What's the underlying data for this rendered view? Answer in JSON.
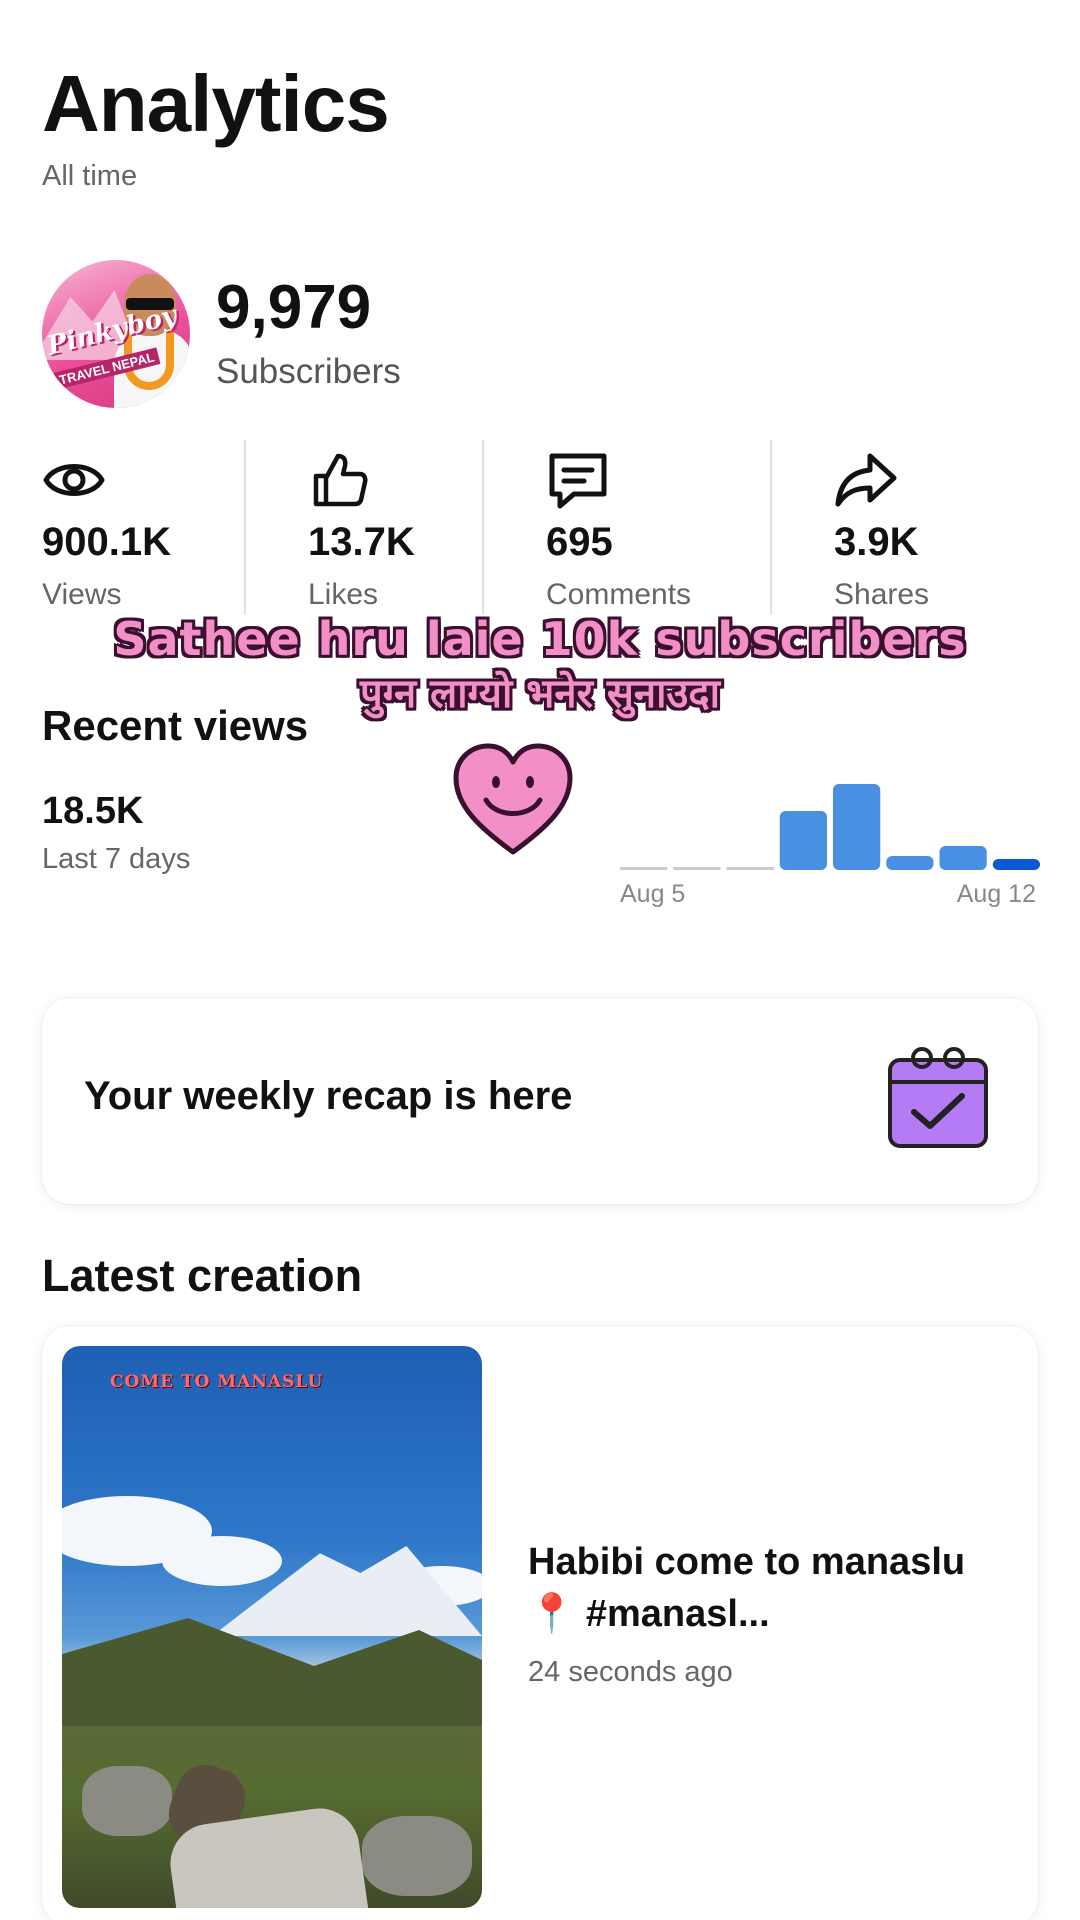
{
  "header": {
    "title": "Analytics",
    "subtitle": "All time"
  },
  "profile": {
    "avatar_brand": "Pinkyboy",
    "avatar_brand_sub": "TRAVEL NEPAL",
    "subscribers": "9,979",
    "subscribers_label": "Subscribers"
  },
  "stats": [
    {
      "icon": "eye-icon",
      "value": "900.1K",
      "label": "Views"
    },
    {
      "icon": "thumbs-up-icon",
      "value": "13.7K",
      "label": "Likes"
    },
    {
      "icon": "comment-icon",
      "value": "695",
      "label": "Comments"
    },
    {
      "icon": "share-icon",
      "value": "3.9K",
      "label": "Shares"
    }
  ],
  "overlay": {
    "line1": "Sathee hru laie 10k subscribers",
    "line2": "पुग्न लाग्यो भनेर सुनाउदा"
  },
  "recent_views": {
    "title": "Recent views",
    "count": "18.5K",
    "period": "Last 7 days",
    "x_start": "Aug 5",
    "x_end": "Aug 12"
  },
  "chart_data": {
    "type": "bar",
    "categories": [
      "Aug 5",
      "Aug 6",
      "Aug 7",
      "Aug 8",
      "Aug 9",
      "Aug 10",
      "Aug 11",
      "Aug 12"
    ],
    "values": [
      0,
      0,
      0,
      5.9,
      8.6,
      1.4,
      2.4,
      1.1
    ],
    "highlight_index": 7,
    "colors": {
      "bar": "#4a90e2",
      "highlight": "#0a5ad1",
      "zero": "#cccccc"
    }
  },
  "recap": {
    "text": "Your weekly recap is here",
    "icon": "calendar-check-icon"
  },
  "latest": {
    "title": "Latest creation",
    "thumb_caption": "COME TO MANASLU",
    "video_title": "Habibi come to manaslu 📍 #manasl...",
    "time": "24 seconds ago"
  },
  "colors": {
    "accent": "#0a5ad1",
    "overlay_pink": "#f28fc6",
    "recap_purple": "#b57bf5"
  }
}
